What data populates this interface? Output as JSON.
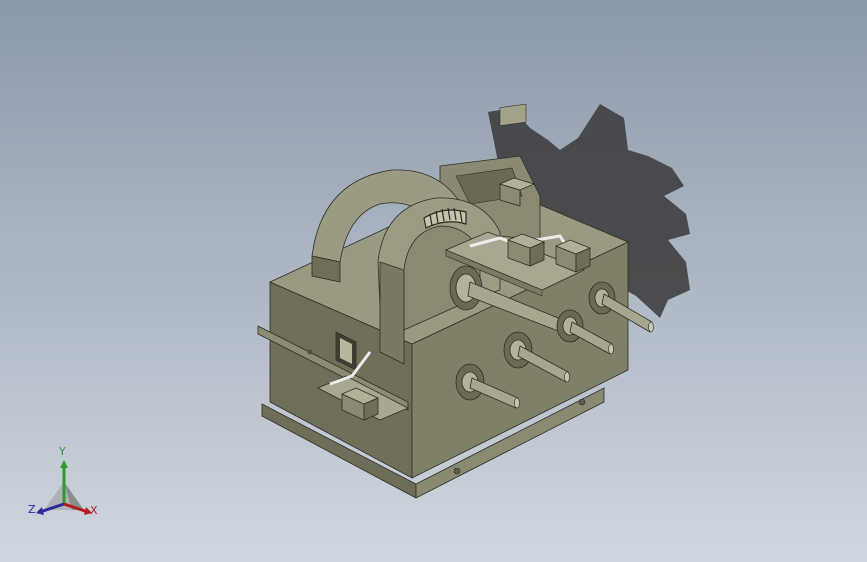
{
  "viewport": {
    "background_top": "#8c99aa",
    "background_bottom": "#cfd6df",
    "model_color": "#7d7c66"
  },
  "triad": {
    "x_label": "X",
    "y_label": "Y",
    "z_label": "Z",
    "x_color": "#b51e1e",
    "y_color": "#2e9b2e",
    "z_color": "#2a2a9a"
  }
}
